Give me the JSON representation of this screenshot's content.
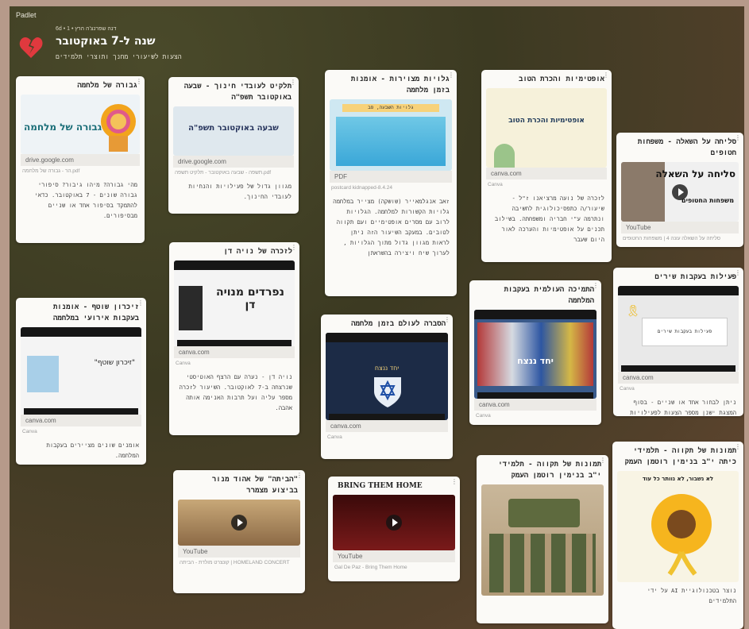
{
  "app": {
    "logo": "Padlet"
  },
  "board": {
    "meta": "6d • 1 • דנה שפרנצ'ה הרץ",
    "title": "שנה ל-7 באוקטובר",
    "subtitle": "הצעות לשיעורי מחנך ותוצרי תלמידים"
  },
  "cards": [
    {
      "title": "גבורה של מלחמה",
      "preview_text": "גבורה של מלחמה",
      "source": "drive.google.com",
      "caption": "pdf.הר - גבורה של מלחמה",
      "body": "מהי גבורה? מיהו גיבור? סיפורי גבורה שונים - 7 באוקטובר. כדאי להתמקד בסיפור אחד או שניים מבסיפורים."
    },
    {
      "title": "תלקיט לעובדי חינוך - שבעה באוקטובר תשפ\"ה",
      "preview_text": "שבעה באוקטובר תשפ\"ה",
      "source": "drive.google.com",
      "caption": "pdf.תשפה - שבעה באוקטובר - תלקיט תשפה",
      "body": "מגוון גדול של פעילויות והנחיות לעובדי החינוך."
    },
    {
      "title": "גלויות מצוירות - אומנות בזמן מלחמה",
      "preview_text": "גלויות השבעה, פב",
      "source": "PDF",
      "caption": "postcard kidnapped-8.4.24",
      "body": "זאב אנגלמאייר (שושקה) מצייר במלחמה גלויות הקשורות למלחמה. הגלויות לרוב עם מסרים אופטימיים ועם תקווה לטובים. במעקב השיעור הזה ניתן לראות מגוון גדול מתוך הגלויות , לערוך שיח ויצירה בהשראתן"
    },
    {
      "title": "אופטימיות והכרת הטוב",
      "preview_text": "אופטימיות והכרת הטוב",
      "source": "canva.com",
      "caption": "Canva",
      "body": "לזכרה של נועה מרציאנו ז\"ל - שיעור/ה כתפסיכולוגית לחשיבה ונתרמה ע\"י חבריה ומשפחתה. בשילוב תכנים על אופטימיות והערכה לאור היום שעבר"
    },
    {
      "title": "סליחה על השאלה - משפחות חטופים",
      "preview_text": "סליחה על השאלה",
      "preview_sub": "משפחות החטופים",
      "source": "YouTube",
      "caption": "סליחה על השאלה עונה 4 | משפחות החטופים",
      "body": ""
    },
    {
      "title": "לזכרה של נויה דן",
      "preview_text": "נפרדים מנויה דן",
      "source": "canva.com",
      "caption": "Canva",
      "body": "נויה דן - נערה עם הרצף האוטיסטי שנרצחה ב-7 לאוקטובר. השיעור לזכרה מספר עליה ועל תרבות האנימה אותה אהבה."
    },
    {
      "title": "זיכרון שוטף - אומנות בעקבות אירועי במלחמה",
      "preview_text": "\"זיכרון שוטף\"",
      "source": "canva.com",
      "caption": "Canva",
      "body": "אומנים שונים מציירים בעקבות המלחמה."
    },
    {
      "title": "הסברה לעולם בזמן מלחמה",
      "preview_text": "יחד ננצח",
      "source": "canva.com",
      "caption": "Canva",
      "body": ""
    },
    {
      "title": "התמיכה העולמית בעקבות המלחמה",
      "preview_text": "יחד ננצח",
      "source": "canva.com",
      "caption": "Canva",
      "body": ""
    },
    {
      "title": "פעילות בעקבות שירים",
      "preview_text": "פעילות בעקבות שירים",
      "source": "canva.com",
      "caption": "Canva",
      "body": "ניתן לבחור אחד או שניים - בסוף המצגת ישנן מספר הצעות לפעילויות בעקבות השירים"
    },
    {
      "title": "\"הביתה\" של אהוד מנור בביצוע מצמרר",
      "source": "YouTube",
      "caption": "HOMELAND CONCERT | קונצרט מולדת - הביתה",
      "body": ""
    },
    {
      "title": "BRING THEM HOME",
      "source": "YouTube",
      "caption": "Gal De Paz - Bring Them Home",
      "body": ""
    },
    {
      "title": "תמונות של תקווה - תלמידי י\"ב בנימין רוטמן העמק",
      "body": ""
    },
    {
      "title": "תמונות של תקווה - תלמידי כיתה י\"ב בנימין רוטמן העמק",
      "preview_text": "לא נשבור, לא נוותר כל עוד",
      "body": "נוצר בטכנולוגיית AI על ידי התלמידים"
    }
  ],
  "colors": {
    "board_bg": "#3f3c24",
    "card_bg": "#fbfaf7",
    "heart": "#e0393e"
  },
  "icons": [
    "broken-heart-icon",
    "play-icon",
    "more-icon",
    "ribbon-icon"
  ]
}
